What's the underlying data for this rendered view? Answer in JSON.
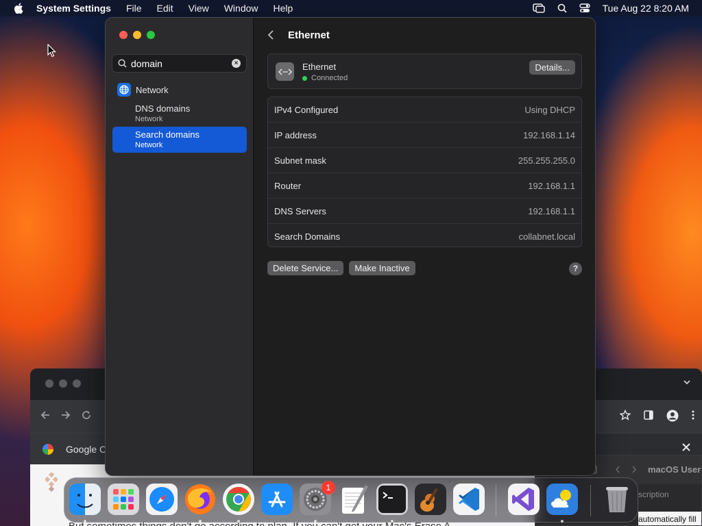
{
  "menubar": {
    "app_name": "System Settings",
    "menus": [
      "File",
      "Edit",
      "View",
      "Window",
      "Help"
    ],
    "clock": "Tue Aug 22  8:20 AM"
  },
  "settings": {
    "search": {
      "value": "domain"
    },
    "nav_header": "Network",
    "results": [
      {
        "title": "DNS domains",
        "subtitle": "Network",
        "selected": false
      },
      {
        "title": "Search domains",
        "subtitle": "Network",
        "selected": true
      }
    ],
    "content": {
      "title": "Ethernet",
      "service": {
        "name": "Ethernet",
        "status": "Connected",
        "details_label": "Details..."
      },
      "rows": [
        {
          "label": "IPv4 Configured",
          "value": "Using DHCP"
        },
        {
          "label": "IP address",
          "value": "192.168.1.14"
        },
        {
          "label": "Subnet mask",
          "value": "255.255.255.0"
        },
        {
          "label": "Router",
          "value": "192.168.1.1"
        },
        {
          "label": "DNS Servers",
          "value": "192.168.1.1"
        },
        {
          "label": "Search Domains",
          "value": "collabnet.local"
        }
      ],
      "delete_label": "Delete Service...",
      "inactive_label": "Make Inactive",
      "help_label": "?"
    }
  },
  "background": {
    "chrome_tab": "Google C",
    "chrome_snippet": "But sometimes things don't go according to plan. If you can't get your Mac's Erase A",
    "doc_title": "macOS User",
    "doc_sub": "scription",
    "doc_auto": "automatically fill"
  },
  "dock": {
    "apps": [
      "Finder",
      "Launchpad",
      "Safari",
      "Firefox",
      "Chrome",
      "App Store",
      "System Settings",
      "TextEdit",
      "Terminal",
      "GarageBand",
      "VS Code",
      "Visual Studio",
      "Weather",
      "Trash"
    ],
    "settings_badge": "1"
  },
  "colors": {
    "accent": "#1459d6",
    "connected": "#30d158"
  }
}
